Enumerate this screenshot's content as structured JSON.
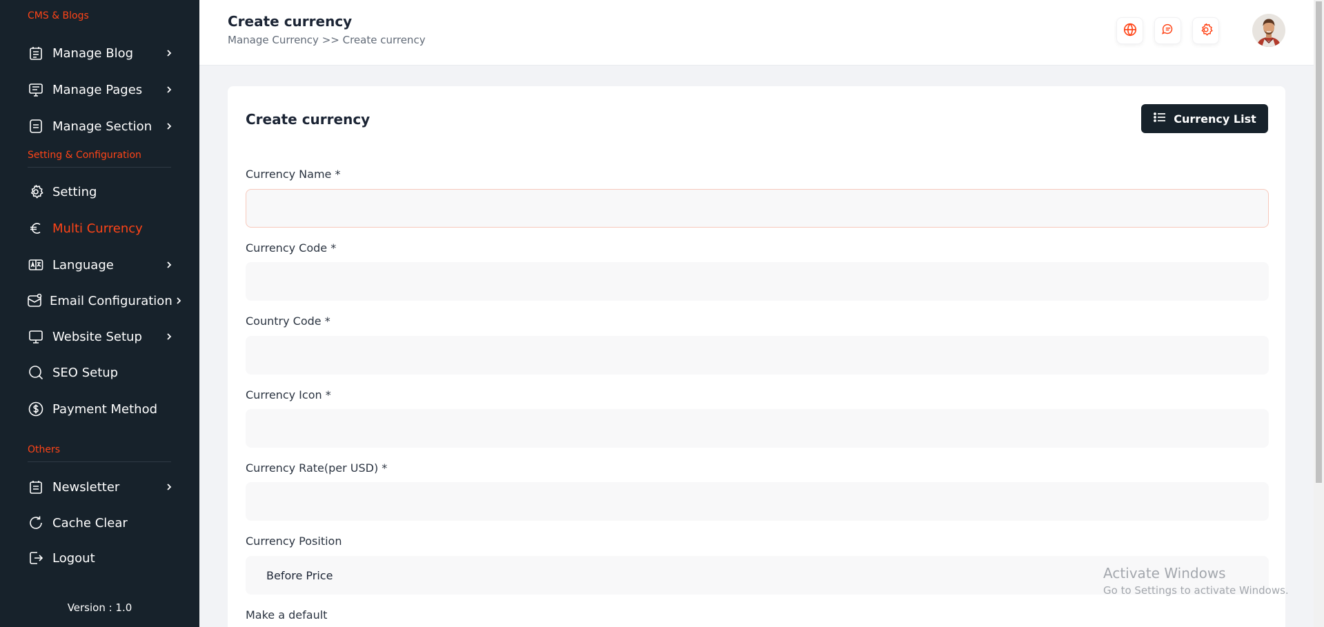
{
  "sidebar": {
    "sections": [
      {
        "title": "CMS & Blogs"
      },
      {
        "title": "Setting & Configuration"
      },
      {
        "title": "Others"
      }
    ],
    "items": [
      {
        "label": "Manage Blog",
        "icon": "blog-icon"
      },
      {
        "label": "Manage Pages",
        "icon": "pages-icon"
      },
      {
        "label": "Manage Section",
        "icon": "section-icon"
      },
      {
        "label": "Setting",
        "icon": "gear-icon"
      },
      {
        "label": "Multi Currency",
        "icon": "euro-icon"
      },
      {
        "label": "Language",
        "icon": "language-icon"
      },
      {
        "label": "Email Configuration",
        "icon": "email-icon"
      },
      {
        "label": "Website Setup",
        "icon": "monitor-icon"
      },
      {
        "label": "SEO Setup",
        "icon": "search-icon"
      },
      {
        "label": "Payment Method",
        "icon": "dollar-icon"
      },
      {
        "label": "Newsletter",
        "icon": "newsletter-icon"
      },
      {
        "label": "Cache Clear",
        "icon": "refresh-icon"
      },
      {
        "label": "Logout",
        "icon": "logout-icon"
      }
    ],
    "version": "Version : 1.0"
  },
  "header": {
    "title": "Create currency",
    "breadcrumb": "Manage Currency >> Create currency",
    "icons": [
      "globe-icon",
      "chat-icon",
      "gear-icon"
    ]
  },
  "form": {
    "title": "Create currency",
    "list_button": "Currency List",
    "fields": [
      {
        "label": "Currency Name *",
        "value": ""
      },
      {
        "label": "Currency Code *",
        "value": ""
      },
      {
        "label": "Country Code *",
        "value": ""
      },
      {
        "label": "Currency Icon *",
        "value": ""
      },
      {
        "label": "Currency Rate(per USD) *",
        "value": ""
      }
    ],
    "position_label": "Currency Position",
    "position_value": "Before Price",
    "default_label": "Make a default"
  },
  "watermark": {
    "line1": "Activate Windows",
    "line2": "Go to Settings to activate Windows."
  },
  "colors": {
    "sidebar_bg": "#17222b",
    "accent": "#ff4417",
    "button_bg": "#17222b"
  }
}
